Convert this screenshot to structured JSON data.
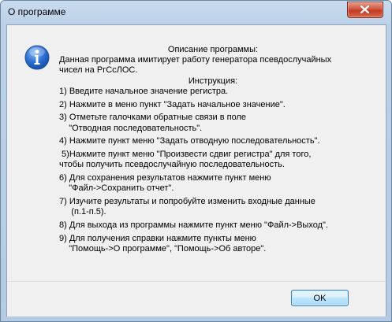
{
  "window": {
    "title": "О программе",
    "close_icon": "close-x-icon"
  },
  "message": {
    "icon": "info-icon",
    "heading": "Описание программы:",
    "description_lines": [
      "Данная программа имитирует работу генератора псевдослучайных",
      "чисел на РгСсЛОС."
    ],
    "instruction_heading": "Инструкция:",
    "steps": [
      [
        "1) Введите начальное значение регистра."
      ],
      [
        "2) Нажмите в меню пункт \"Задать начальное значение\"."
      ],
      [
        "3) Отметьте галочками обратные связи в поле",
        "    \"Отводная последовательность\"."
      ],
      [
        "4) Нажмите пункт меню \"Задать отводную последовательность\"."
      ],
      [
        " 5)Нажмите пункт меню \"Произвести сдвиг регистра\" для того,",
        "чтобы получить псевдослучайную последовательность."
      ],
      [
        "6) Для сохранения результатов нажмите пункт меню",
        "    \"Файл->Сохранить отчет\"."
      ],
      [
        "7) Изучите результаты и попробуйте изменить входные данные",
        "     (п.1-п.5)."
      ],
      [
        "8) Для выхода из программы нажмите пункт меню \"Файл->Выход\"."
      ],
      [
        "9) Для получения справки нажмите пункты меню",
        "    \"Помощь->О программе\", \"Помощь->Об авторе\"."
      ]
    ]
  },
  "buttons": {
    "ok_label": "OK"
  }
}
